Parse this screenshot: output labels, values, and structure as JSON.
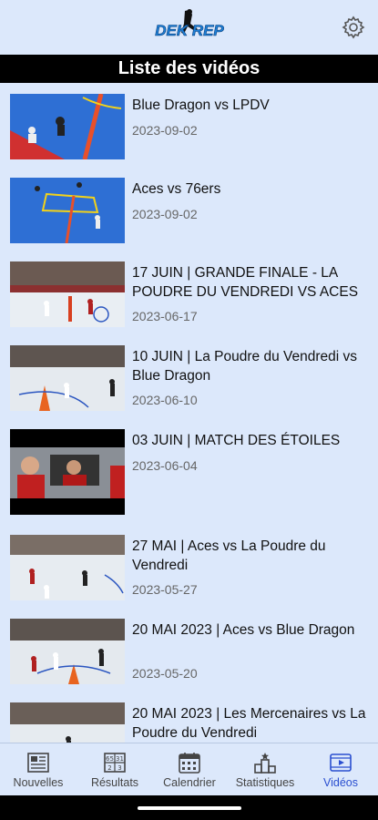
{
  "header": {
    "logo_text": "DEK REP",
    "settings_icon": "gear-icon"
  },
  "page": {
    "title": "Liste des vidéos"
  },
  "videos": [
    {
      "title": "Blue Dragon vs LPDV",
      "date": "2023-09-02"
    },
    {
      "title": "Aces vs 76ers",
      "date": "2023-09-02"
    },
    {
      "title": "17 JUIN | GRANDE FINALE - LA POUDRE DU VENDREDI VS ACES",
      "date": "2023-06-17"
    },
    {
      "title": "10 JUIN | La Poudre du Vendredi vs Blue Dragon",
      "date": "2023-06-10"
    },
    {
      "title": "03 JUIN | MATCH DES ÉTOILES",
      "date": "2023-06-04"
    },
    {
      "title": "27 MAI | Aces vs La Poudre du Vendredi",
      "date": "2023-05-27"
    },
    {
      "title": "20 MAI 2023 | Aces vs Blue Dragon",
      "date": "2023-05-20"
    },
    {
      "title": "20 MAI 2023 | Les Mercenaires vs La Poudre du Vendredi",
      "date": ""
    }
  ],
  "nav": {
    "items": [
      {
        "label": "Nouvelles",
        "icon": "newspaper-icon"
      },
      {
        "label": "Résultats",
        "icon": "scoreboard-icon"
      },
      {
        "label": "Calendrier",
        "icon": "calendar-icon"
      },
      {
        "label": "Statistiques",
        "icon": "podium-icon"
      },
      {
        "label": "Vidéos",
        "icon": "video-icon"
      }
    ],
    "active": "Vidéos"
  },
  "colors": {
    "background": "#dce8fb",
    "title_bar": "#000000",
    "active_nav": "#2a4fd0",
    "court_blue": "#2e6fd4"
  }
}
